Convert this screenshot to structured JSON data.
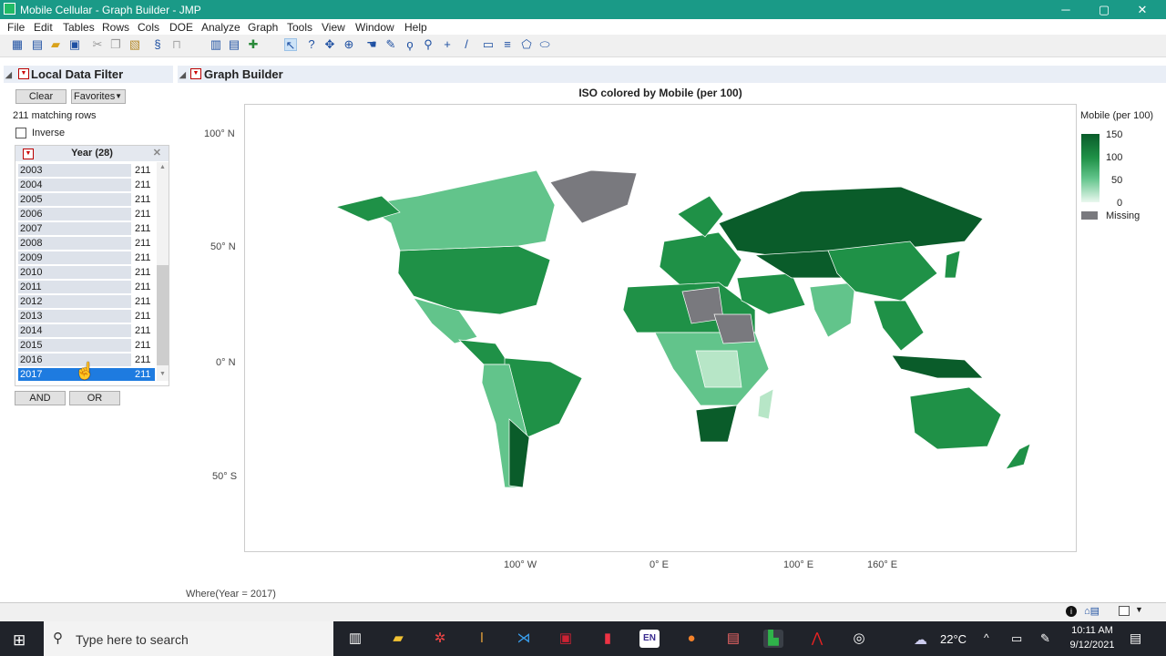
{
  "window": {
    "title": "Mobile Cellular - Graph Builder - JMP",
    "min": "─",
    "max": "▢",
    "close": "✕"
  },
  "menu": [
    "File",
    "Edit",
    "Tables",
    "Rows",
    "Cols",
    "DOE",
    "Analyze",
    "Graph",
    "Tools",
    "View",
    "Window",
    "Help"
  ],
  "filter": {
    "header": "Local Data Filter",
    "clear": "Clear",
    "favorites": "Favorites",
    "matching": "211 matching rows",
    "inverse": "Inverse",
    "year_header": "Year (28)",
    "years": [
      {
        "year": "2003",
        "count": "211"
      },
      {
        "year": "2004",
        "count": "211"
      },
      {
        "year": "2005",
        "count": "211"
      },
      {
        "year": "2006",
        "count": "211"
      },
      {
        "year": "2007",
        "count": "211"
      },
      {
        "year": "2008",
        "count": "211"
      },
      {
        "year": "2009",
        "count": "211"
      },
      {
        "year": "2010",
        "count": "211"
      },
      {
        "year": "2011",
        "count": "211"
      },
      {
        "year": "2012",
        "count": "211"
      },
      {
        "year": "2013",
        "count": "211"
      },
      {
        "year": "2014",
        "count": "211"
      },
      {
        "year": "2015",
        "count": "211"
      },
      {
        "year": "2016",
        "count": "211"
      },
      {
        "year": "2017",
        "count": "211"
      }
    ],
    "selected_year": "2017",
    "and": "AND",
    "or": "OR"
  },
  "graph": {
    "header": "Graph Builder",
    "title": "ISO colored by Mobile (per 100)",
    "y_ticks": [
      "100° N",
      "50° N",
      "0° N",
      "50° S"
    ],
    "x_ticks": [
      "100° W",
      "0° E",
      "100° E",
      "160° E"
    ],
    "where": "Where(Year = 2017)",
    "legend": {
      "title": "Mobile (per 100)",
      "ticks": [
        "150",
        "100",
        "50",
        "0"
      ],
      "missing": "Missing",
      "colors": {
        "high": "#0a5c2a",
        "mid": "#1f9147",
        "low": "#62c48b",
        "zero": "#eaf8ef",
        "missing": "#79797e"
      }
    }
  },
  "taskbar": {
    "search": "Type here to search",
    "temp": "22°C",
    "time": "10:11 AM",
    "date": "9/12/2021",
    "lang": "EN"
  }
}
